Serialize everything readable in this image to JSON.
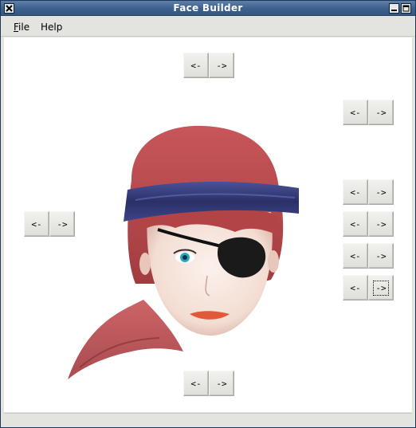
{
  "window": {
    "title": "Face Builder"
  },
  "menu": {
    "file": {
      "mnemonic": "F",
      "rest": "ile"
    },
    "help": "Help"
  },
  "selectors": [
    {
      "id": "top",
      "prev_label": "<-",
      "next_label": "->"
    },
    {
      "id": "right-1",
      "prev_label": "<-",
      "next_label": "->"
    },
    {
      "id": "left",
      "prev_label": "<-",
      "next_label": "->"
    },
    {
      "id": "right-2",
      "prev_label": "<-",
      "next_label": "->"
    },
    {
      "id": "right-3",
      "prev_label": "<-",
      "next_label": "->"
    },
    {
      "id": "right-4",
      "prev_label": "<-",
      "next_label": "->"
    },
    {
      "id": "right-5",
      "prev_label": "<-",
      "next_label": "->"
    },
    {
      "id": "bottom",
      "prev_label": "<-",
      "next_label": "->"
    }
  ],
  "colors": {
    "hair": "#b8474a",
    "headband": "#353b78",
    "eyepatch": "#1a1a1a",
    "eye": "#2aa7c0",
    "lips": "#e0593a",
    "skin": "#f7e7de",
    "titlebar": "#3e6290"
  }
}
